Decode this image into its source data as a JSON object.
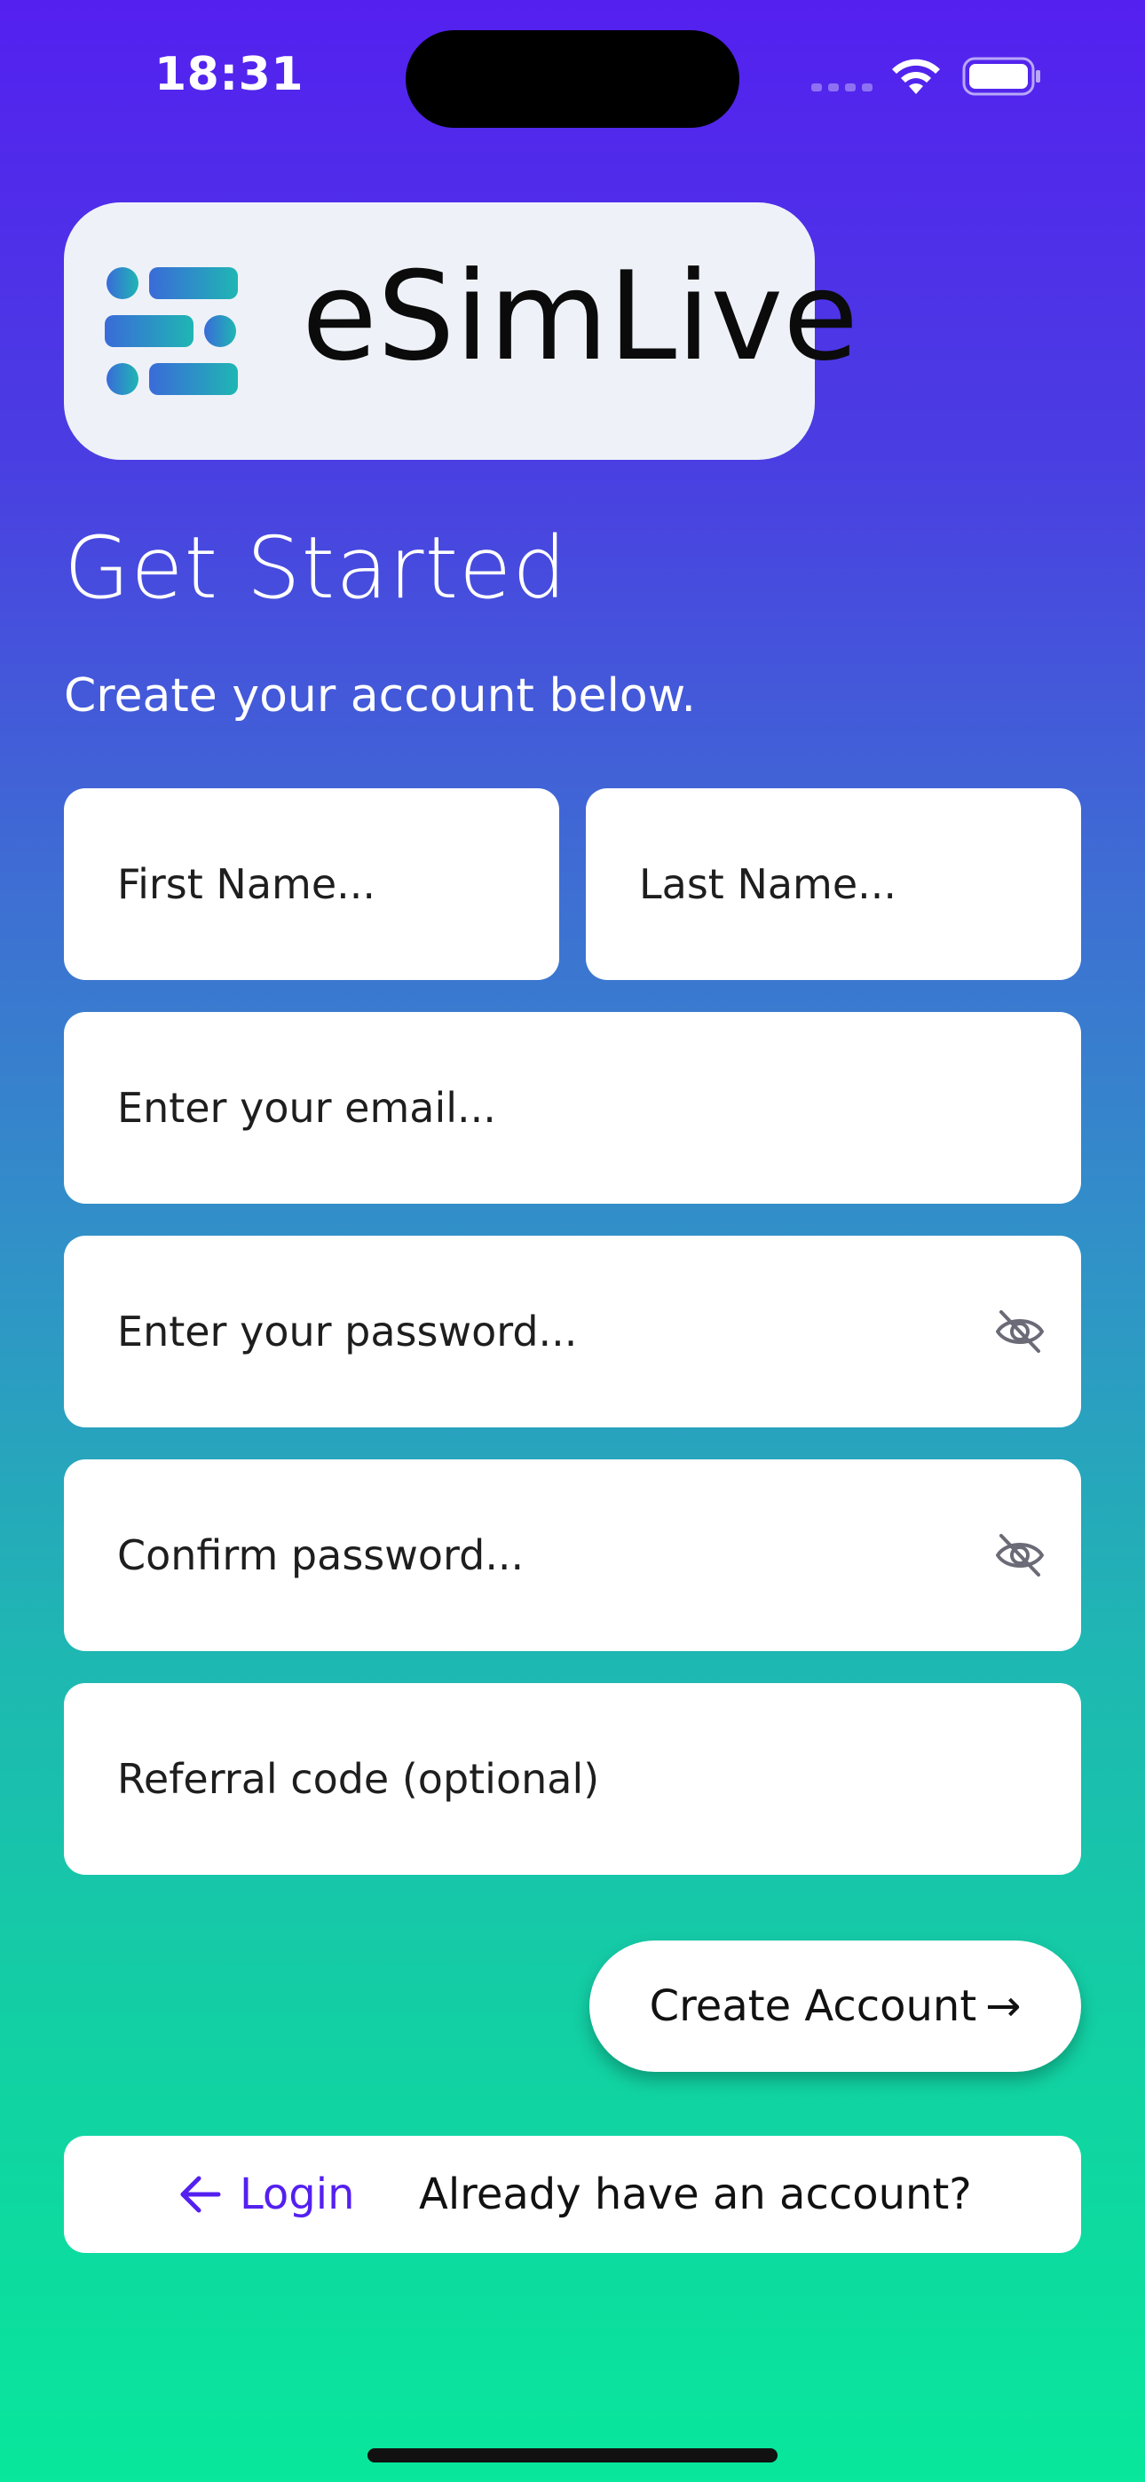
{
  "status_bar": {
    "time": "18:31"
  },
  "brand": {
    "name": "eSimLive",
    "logo_colors": [
      "#3A6BD9",
      "#1FB6B3"
    ]
  },
  "header": {
    "title": "Get Started",
    "subtitle": "Create your account below."
  },
  "form": {
    "first_name": {
      "value": "",
      "placeholder": "First Name..."
    },
    "last_name": {
      "value": "",
      "placeholder": "Last Name..."
    },
    "email": {
      "value": "",
      "placeholder": "Enter your email..."
    },
    "password": {
      "value": "",
      "placeholder": "Enter your password...",
      "icon": "eye-off-icon"
    },
    "confirm_password": {
      "value": "",
      "placeholder": "Confirm password...",
      "icon": "eye-off-icon"
    },
    "referral": {
      "value": "",
      "placeholder": "Referral code (optional)"
    }
  },
  "actions": {
    "create_account_label": "Create Account",
    "create_account_arrow": "→"
  },
  "footer": {
    "login_label": "Login",
    "login_icon": "arrow-left-icon",
    "question": "Already have an account?"
  },
  "colors": {
    "accent": "#5420F0",
    "gradient_top": "#5420F0",
    "gradient_bottom": "#08E79C"
  }
}
